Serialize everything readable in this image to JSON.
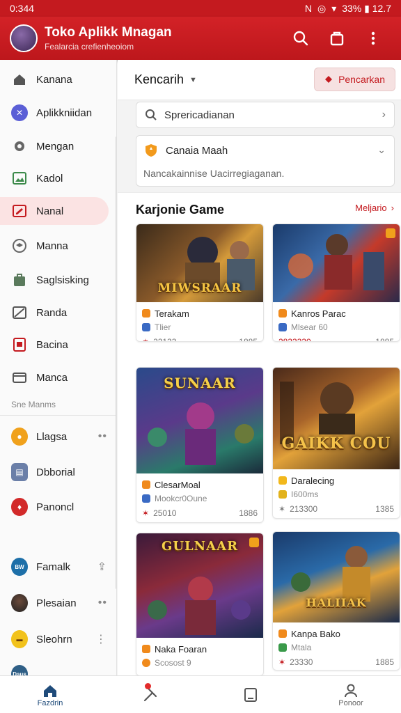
{
  "status_bar": {
    "time": "0:344",
    "battery": "33% ▮ 12.7"
  },
  "app": {
    "title": "Toko Aplikk Mnagan",
    "subtitle": "Fealarcia crefienheoiom",
    "accent": "#c41a1f"
  },
  "sidebar": {
    "items": [
      {
        "label": "Kanana",
        "icon": "home-icon"
      },
      {
        "label": "Aplikkniidan",
        "icon": "tools-icon"
      },
      {
        "label": "Mengan",
        "icon": "gear-icon"
      },
      {
        "label": "Kadol",
        "icon": "image-icon"
      },
      {
        "label": "Nanal",
        "icon": "edit-icon"
      },
      {
        "label": "Manna",
        "icon": "layers-icon"
      },
      {
        "label": "Saglsisking",
        "icon": "bag-icon"
      },
      {
        "label": "Randa",
        "icon": "picture-icon"
      },
      {
        "label": "Bacina",
        "icon": "book-icon"
      },
      {
        "label": "Manca",
        "icon": "card-icon"
      }
    ],
    "section_label": "Sne Manms",
    "apps": [
      {
        "label": "Llagsa",
        "icon": "orange-app-icon"
      },
      {
        "label": "Dbborial",
        "icon": "doc-app-icon"
      },
      {
        "label": "Panoncl",
        "icon": "red-app-icon"
      },
      {
        "label": "Famalk",
        "icon": "blue-app-icon"
      },
      {
        "label": "Plesaian",
        "icon": "person-avatar-icon"
      },
      {
        "label": "Sleohrn",
        "icon": "yellow-app-icon"
      },
      {
        "label": "Daus"
      }
    ]
  },
  "main": {
    "filter_label": "Kencarih",
    "search_button": "Pencarkan",
    "search_placeholder": "Sprericadianan",
    "notice_title": "Canaia Maah",
    "notice_body": "Nancakainnise Uacirregiaganan.",
    "section_title": "Karjonie Game",
    "section_more": "Meljario"
  },
  "games": [
    {
      "banner": "MIWSRAAR",
      "title": "Terakam",
      "dev": "Tlier",
      "rating": "22133",
      "size": "1885",
      "rating_red": false,
      "dev_red": false
    },
    {
      "banner": "",
      "title": "Kanros Parac",
      "dev": "Mlsear 60",
      "rating": "2833330",
      "size": "1885",
      "rating_red": true,
      "dev_red": false
    },
    {
      "banner": "SUNAAR",
      "title": "ClesarMoal",
      "dev": "Mookcr0Oune",
      "rating": "25010",
      "size": "1886",
      "rating_red": false,
      "dev_red": true
    },
    {
      "banner": "GAIKK COU",
      "title": "Daralecing",
      "dev": "I600ms",
      "rating": "213300",
      "size": "1385",
      "rating_red": false,
      "dev_red": false
    },
    {
      "banner": "GULNAAR",
      "title": "Naka Foaran",
      "dev": "Scosost 9",
      "rating": "",
      "size": "",
      "rating_red": false,
      "dev_red": false
    },
    {
      "banner": "HALIIAK",
      "title": "Kanpa Bako",
      "dev": "Mtala",
      "rating": "23330",
      "size": "1885",
      "rating_red": false,
      "dev_red": false
    }
  ],
  "bottom_nav": [
    {
      "label": "Fazdrin",
      "icon": "home-icon"
    },
    {
      "label": "",
      "icon": "tools-icon"
    },
    {
      "label": "",
      "icon": "tablet-icon"
    },
    {
      "label": "Ponoor",
      "icon": "person-icon"
    }
  ]
}
